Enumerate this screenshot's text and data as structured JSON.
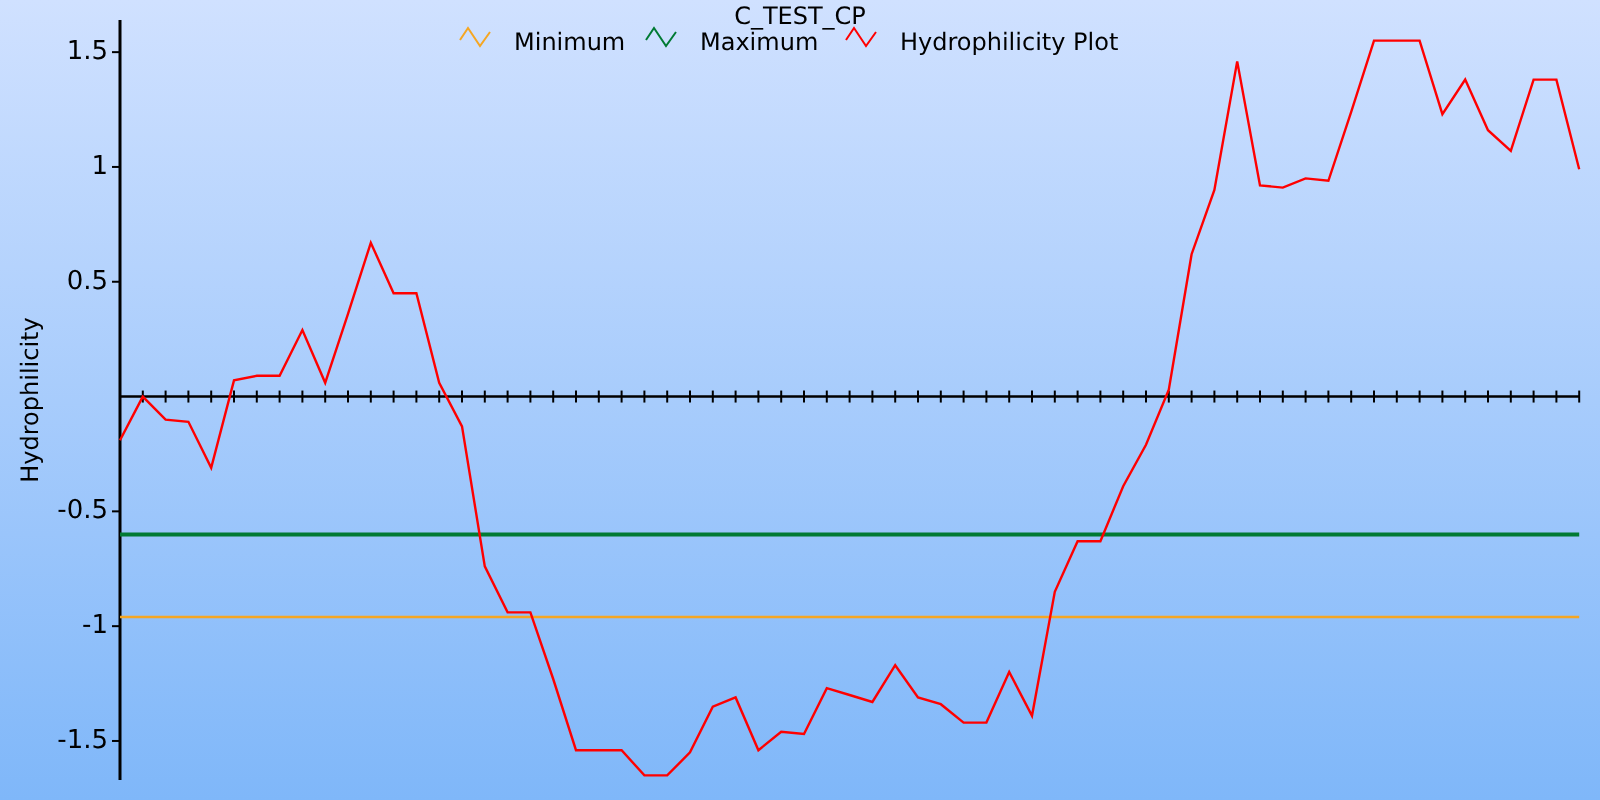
{
  "chart": {
    "chart_data": {
      "type": "line",
      "title": "C_TEST_CP",
      "legend": true,
      "ylabel": "Hydrophilicity",
      "ylim": [
        -1.67,
        1.64
      ],
      "yticks": [
        1.5,
        1,
        0.5,
        -0.5,
        -1,
        -1.5
      ],
      "categories": [
        null,
        null,
        null,
        null,
        null,
        null,
        null,
        null,
        null,
        null,
        null,
        null,
        null,
        null,
        null,
        null,
        null,
        null,
        null,
        null,
        null,
        null,
        null,
        null,
        null,
        null,
        null,
        null,
        null,
        null,
        null,
        null,
        null,
        null,
        null,
        null,
        null,
        null,
        null,
        null,
        null,
        null,
        null,
        null,
        null,
        null,
        null,
        null,
        null,
        null,
        null,
        null,
        null,
        null,
        null,
        null,
        null,
        null,
        null,
        null,
        null,
        null,
        null,
        null,
        null
      ],
      "series": [
        {
          "name": "Minimum",
          "color": "#f5a623",
          "values": [
            -0.96,
            -0.96,
            -0.96,
            -0.96,
            -0.96,
            -0.96,
            -0.96,
            -0.96,
            -0.96,
            -0.96,
            -0.96,
            -0.96,
            -0.96,
            -0.96,
            -0.96,
            -0.96,
            -0.96,
            -0.96,
            -0.96,
            -0.96,
            -0.96,
            -0.96,
            -0.96,
            -0.96,
            -0.96,
            -0.96,
            -0.96,
            -0.96,
            -0.96,
            -0.96,
            -0.96,
            -0.96,
            -0.96,
            -0.96,
            -0.96,
            -0.96,
            -0.96,
            -0.96,
            -0.96,
            -0.96,
            -0.96,
            -0.96,
            -0.96,
            -0.96,
            -0.96,
            -0.96,
            -0.96,
            -0.96,
            -0.96,
            -0.96,
            -0.96,
            -0.96,
            -0.96,
            -0.96,
            -0.96,
            -0.96,
            -0.96,
            -0.96,
            -0.96,
            -0.96,
            -0.96,
            -0.96,
            -0.96,
            -0.96,
            -0.96
          ]
        },
        {
          "name": "Maximum",
          "color": "#007a33",
          "values": [
            -0.6,
            -0.6,
            -0.6,
            -0.6,
            -0.6,
            -0.6,
            -0.6,
            -0.6,
            -0.6,
            -0.6,
            -0.6,
            -0.6,
            -0.6,
            -0.6,
            -0.6,
            -0.6,
            -0.6,
            -0.6,
            -0.6,
            -0.6,
            -0.6,
            -0.6,
            -0.6,
            -0.6,
            -0.6,
            -0.6,
            -0.6,
            -0.6,
            -0.6,
            -0.6,
            -0.6,
            -0.6,
            -0.6,
            -0.6,
            -0.6,
            -0.6,
            -0.6,
            -0.6,
            -0.6,
            -0.6,
            -0.6,
            -0.6,
            -0.6,
            -0.6,
            -0.6,
            -0.6,
            -0.6,
            -0.6,
            -0.6,
            -0.6,
            -0.6,
            -0.6,
            -0.6,
            -0.6,
            -0.6,
            -0.6,
            -0.6,
            -0.6,
            -0.6,
            -0.6,
            -0.6,
            -0.6,
            -0.6,
            -0.6,
            -0.6
          ]
        },
        {
          "name": "Hydrophilicity Plot",
          "color": "#ff0000",
          "values": [
            -0.19,
            0.0,
            -0.1,
            -0.11,
            -0.31,
            0.07,
            0.09,
            0.09,
            0.29,
            0.06,
            0.36,
            0.67,
            0.45,
            0.45,
            0.06,
            -0.13,
            -0.74,
            -0.94,
            -0.94,
            -1.23,
            -1.54,
            -1.54,
            -1.54,
            -1.65,
            -1.65,
            -1.55,
            -1.35,
            -1.31,
            -1.54,
            -1.46,
            -1.47,
            -1.27,
            -1.3,
            -1.33,
            -1.17,
            -1.31,
            -1.34,
            -1.42,
            -1.42,
            -1.2,
            -1.39,
            -0.85,
            -0.63,
            -0.63,
            -0.39,
            -0.21,
            0.03,
            0.62,
            0.9,
            1.46,
            0.92,
            0.91,
            0.95,
            0.94,
            1.24,
            1.55,
            1.55,
            1.55,
            1.23,
            1.38,
            1.16,
            1.07,
            1.38,
            1.38,
            0.99
          ]
        }
      ]
    }
  }
}
